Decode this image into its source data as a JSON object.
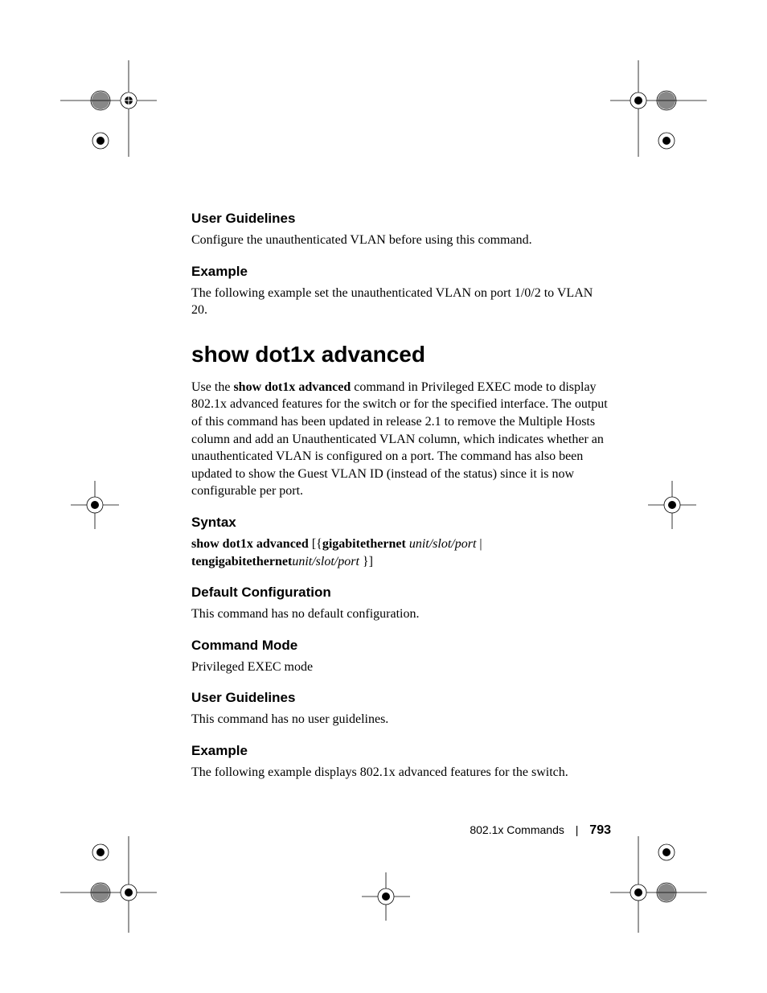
{
  "sections": {
    "user_guidelines_1": {
      "heading": "User Guidelines",
      "body": "Configure the unauthenticated VLAN before using this command."
    },
    "example_1": {
      "heading": "Example",
      "body": "The following example set the unauthenticated VLAN on port 1/0/2 to VLAN 20."
    },
    "command": {
      "title": "show dot1x advanced",
      "description": "Use the show dot1x advanced command in Privileged EXEC mode to display 802.1x advanced features for the switch or for the specified interface. The output of this command has been updated in release 2.1 to remove the Multiple Hosts column and add an Unauthenticated VLAN column, which indicates whether an unauthenticated VLAN is configured on a port. The command has also been updated to show the Guest VLAN ID (instead of the status) since it is now configurable per port."
    },
    "syntax": {
      "heading": "Syntax",
      "cmd_bold1": "show dot1x advanced ",
      "bracket1": "[{",
      "cmd_bold2": "gigabitethernet ",
      "param1": "unit/slot/port",
      "pipe": " | ",
      "cmd_bold3": "tengigabitethernet",
      "param2": "unit/slot/port ",
      "bracket2": "}]"
    },
    "default_config": {
      "heading": "Default Configuration",
      "body": "This command has no default configuration."
    },
    "command_mode": {
      "heading": "Command Mode",
      "body": "Privileged EXEC mode"
    },
    "user_guidelines_2": {
      "heading": "User Guidelines",
      "body": "This command has no user guidelines."
    },
    "example_2": {
      "heading": "Example",
      "body": "The following example displays 802.1x advanced features for the switch."
    }
  },
  "footer": {
    "section_name": "802.1x Commands",
    "page_number": "793"
  },
  "inline": {
    "use_the": "Use the ",
    "cmd_name": "show dot1x advanced",
    "desc_rest": " command in Privileged EXEC mode to display 802.1x advanced features for the switch or for the specified interface. The output of this command has been updated in release 2.1 to remove the Multiple Hosts column and add an Unauthenticated VLAN column, which indicates whether an unauthenticated VLAN is configured on a port. The command has also been updated to show the Guest VLAN ID (instead of the status) since it is now configurable per port."
  }
}
